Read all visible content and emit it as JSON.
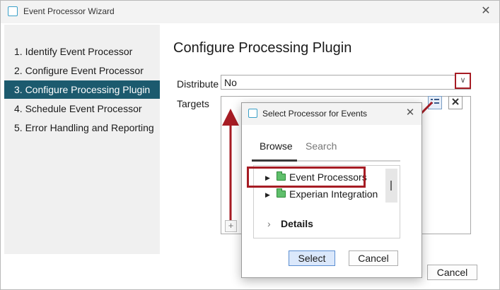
{
  "window": {
    "title": "Event Processor Wizard",
    "close_glyph": "✕"
  },
  "steps": [
    {
      "label": "1. Identify Event Processor",
      "active": false
    },
    {
      "label": "2. Configure Event Processor",
      "active": false
    },
    {
      "label": "3. Configure Processing Plugin",
      "active": true
    },
    {
      "label": "4. Schedule Event Processor",
      "active": false
    },
    {
      "label": "5. Error Handling and Reporting",
      "active": false
    }
  ],
  "page": {
    "title": "Configure Processing Plugin",
    "distribute_label": "Distribute",
    "distribute_value": "No",
    "distribute_dropdown_glyph": "∨",
    "targets_label": "Targets",
    "targets_add_glyph": "+",
    "cancel_label": "Cancel"
  },
  "dialog": {
    "title": "Select Processor for Events",
    "close_glyph": "✕",
    "tabs": [
      {
        "label": "Browse",
        "active": true
      },
      {
        "label": "Search",
        "active": false
      }
    ],
    "tree_items": [
      {
        "label": "Event Processors",
        "highlighted": true
      },
      {
        "label": "Experian Integration",
        "highlighted": false
      }
    ],
    "expand_glyph": "▶",
    "details_chevron": "›",
    "details_label": "Details",
    "select_label": "Select",
    "cancel_label": "Cancel"
  },
  "icons": {
    "app_icon": "window-icon",
    "targets_list_icon": "list-icon",
    "targets_remove_icon": "remove-x-icon",
    "folder_icon": "folder-icon"
  },
  "colors": {
    "active_step_bg": "#1c5a6e",
    "annotation_red": "#a61c24",
    "folder_green": "#5fbf6b",
    "select_button_bg": "#dbe8fb"
  }
}
